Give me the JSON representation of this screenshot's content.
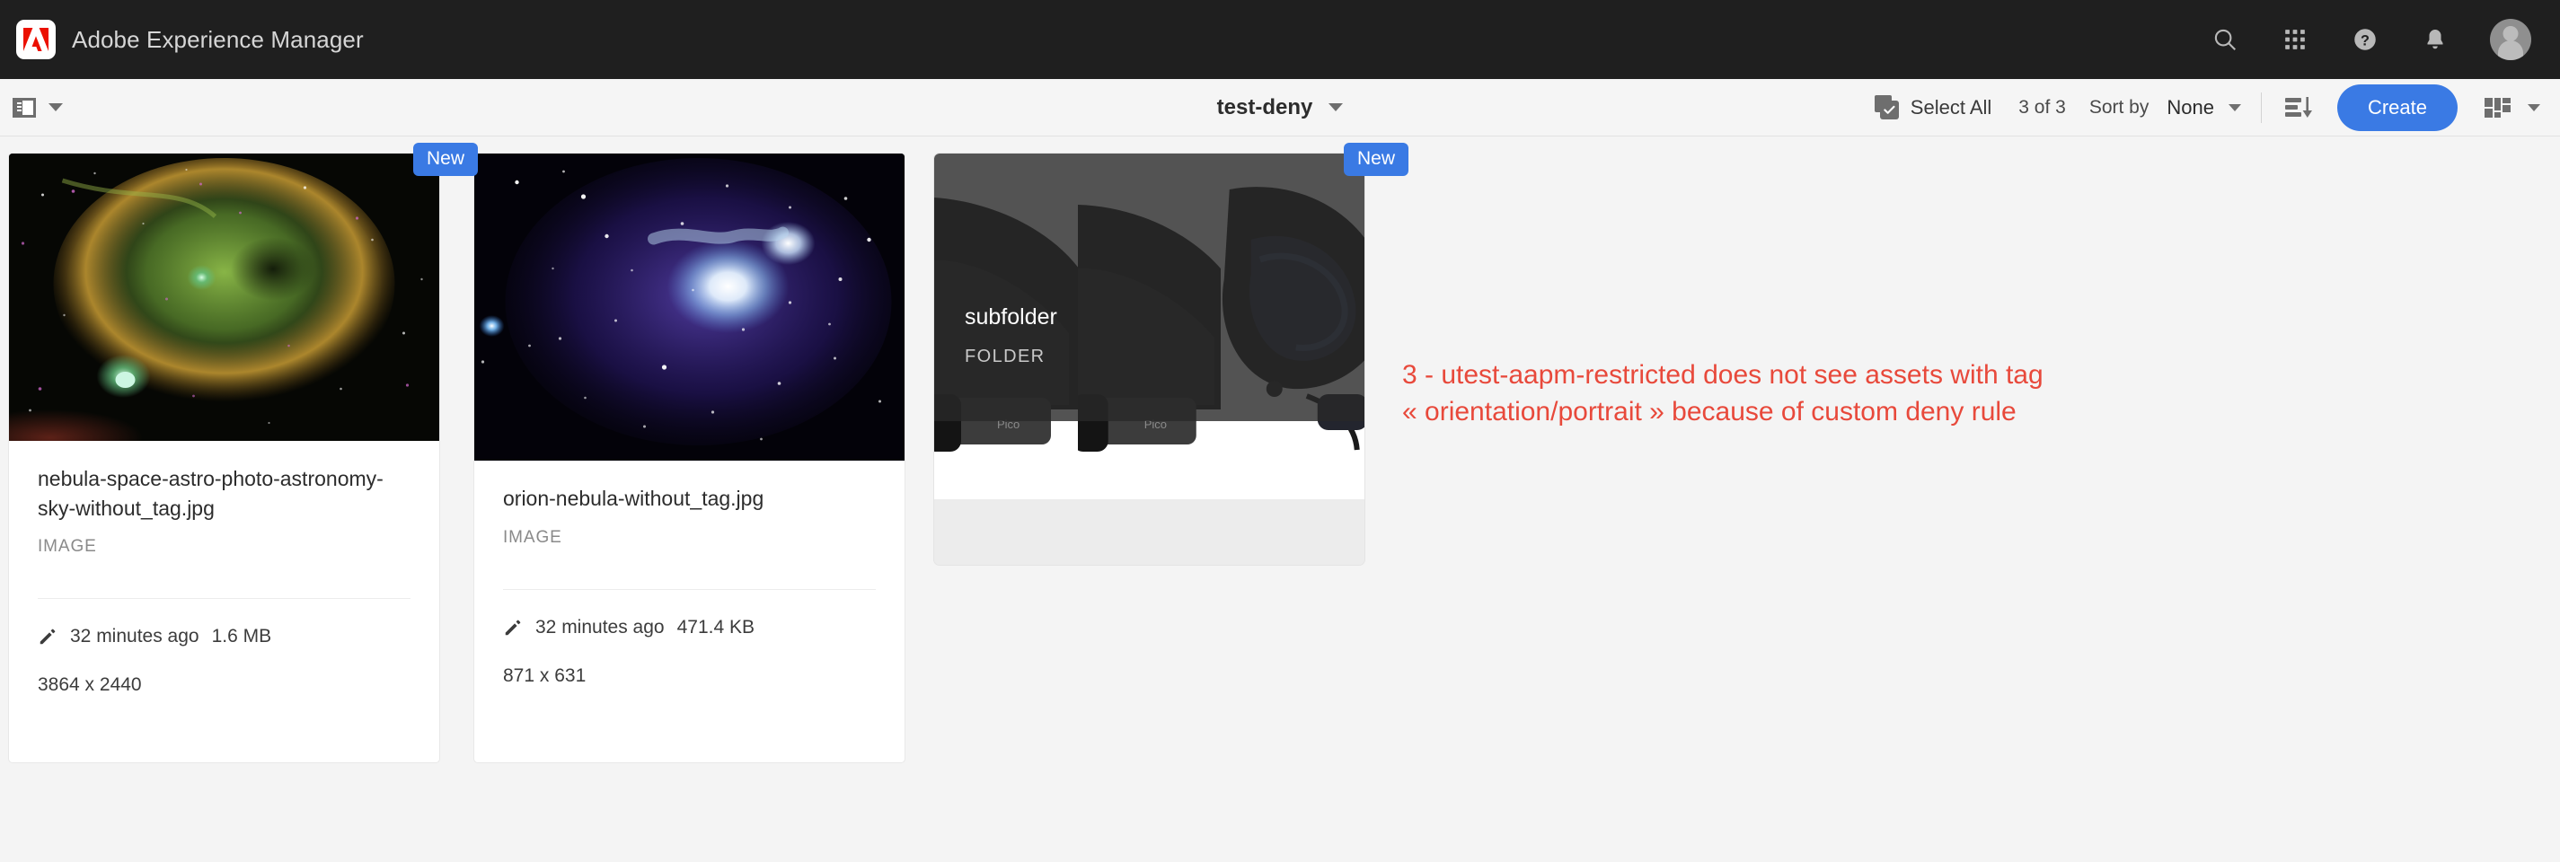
{
  "shell": {
    "brand_title": "Adobe Experience Manager",
    "logo_name": "adobe-logo",
    "icons": [
      {
        "name": "search-icon",
        "label": "Search"
      },
      {
        "name": "app-grid-icon",
        "label": "Solutions"
      },
      {
        "name": "help-icon",
        "label": "Help"
      },
      {
        "name": "bell-icon",
        "label": "Notifications"
      },
      {
        "name": "avatar",
        "label": "User"
      }
    ],
    "background_color": "#1f1f1f",
    "text_color": "#d6d6d6"
  },
  "toolbar": {
    "rail_toggle_label": "",
    "breadcrumb_title": "test-deny",
    "select_all_label": "Select All",
    "count_label": "3 of 3",
    "sort_by_label": "Sort by",
    "sort_value": "None",
    "create_label": "Create",
    "accent_color": "#3a7ae4",
    "background_color": "#f5f5f5"
  },
  "annotation": {
    "line1": "3 - utest-aapm-restricted does not see assets with tag",
    "line2": "« orientation/portrait » because of custom deny rule",
    "color": "#e8493b"
  },
  "cards": [
    {
      "badge": "New",
      "title": "nebula-space-astro-photo-astronomy-sky-without_tag.jpg",
      "kind": "IMAGE",
      "modified": "32 minutes ago",
      "size": "1.6 MB",
      "dimensions": "3864 x 2440"
    },
    {
      "badge": "New",
      "title": "orion-nebula-without_tag.jpg",
      "kind": "IMAGE",
      "modified": "32 minutes ago",
      "size": "471.4 KB",
      "dimensions": "871 x 631"
    }
  ],
  "folder_card": {
    "name": "subfolder",
    "kind": "FOLDER"
  }
}
